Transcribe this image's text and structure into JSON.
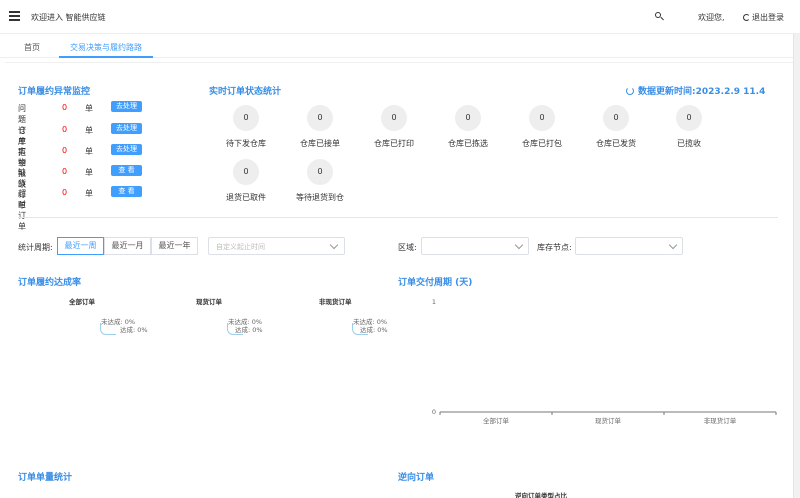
{
  "header": {
    "welcome": "欢迎进入 智能供应链",
    "user": "欢迎您,",
    "logout": "退出登录"
  },
  "tabs": [
    {
      "label": "首页"
    },
    {
      "label": "交易决策与履约路路"
    }
  ],
  "monitor": {
    "title": "订单履约异常监控",
    "rows": [
      {
        "label": "问题订单",
        "value": "0",
        "unit": "单",
        "button": "去处理"
      },
      {
        "label": "仓库拒单",
        "value": "0",
        "unit": "单",
        "button": "去处理"
      },
      {
        "label": "实物报缺",
        "value": "0",
        "unit": "单",
        "button": "去处理"
      },
      {
        "label": "缺货订单",
        "value": "0",
        "unit": "单",
        "button": "查 看"
      },
      {
        "label": "超时订单",
        "value": "0",
        "unit": "单",
        "button": "查 看"
      }
    ]
  },
  "realtime": {
    "title": "实时订单状态统计",
    "update_time": "数据更新时间:2023.2.9 11.4",
    "statuses": [
      {
        "label": "待下发仓库",
        "value": "0"
      },
      {
        "label": "仓库已接单",
        "value": "0"
      },
      {
        "label": "仓库已打印",
        "value": "0"
      },
      {
        "label": "仓库已拣选",
        "value": "0"
      },
      {
        "label": "仓库已打包",
        "value": "0"
      },
      {
        "label": "仓库已发货",
        "value": "0"
      },
      {
        "label": "已揽收",
        "value": "0"
      },
      {
        "label": "退货已取件",
        "value": "0"
      },
      {
        "label": "等待退货到仓",
        "value": "0"
      }
    ]
  },
  "filters": {
    "period_label": "统计周期:",
    "periods": [
      "最近一周",
      "最近一月",
      "最近一年"
    ],
    "date_placeholder": "自定义起止时间",
    "region_label": "区域:",
    "node_label": "库存节点:"
  },
  "fulfillment": {
    "title": "订单履约达成率",
    "charts": [
      {
        "name": "全部订单",
        "legend_miss": "未达成: 0%",
        "legend_hit": "达成: 0%"
      },
      {
        "name": "现货订单",
        "legend_miss": "未达成: 0%",
        "legend_hit": "达成: 0%"
      },
      {
        "name": "非现货订单",
        "legend_miss": "未达成: 0%",
        "legend_hit": "达成: 0%"
      }
    ]
  },
  "chart_data": {
    "type": "bar",
    "title": "订单交付周期 (天)",
    "categories": [
      "全部订单",
      "现货订单",
      "非现货订单"
    ],
    "values": [
      0,
      0,
      0
    ],
    "ylim": [
      0,
      1
    ],
    "yticks": [
      "1",
      "0"
    ],
    "grid": false
  },
  "bottom": {
    "volume_title": "订单单量统计",
    "reverse_title": "逆向订单",
    "reverse_sub": "逆向订单类型占比"
  },
  "colors": {
    "accent": "#409eff",
    "alert": "#ff0000"
  }
}
